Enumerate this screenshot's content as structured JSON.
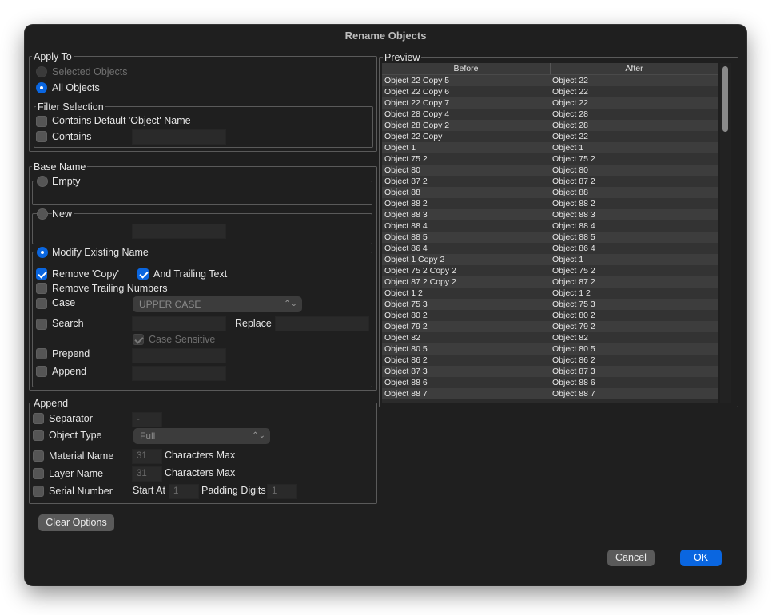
{
  "window": {
    "title": "Rename Objects"
  },
  "apply_to": {
    "legend": "Apply To",
    "selected_objects": "Selected Objects",
    "all_objects": "All Objects",
    "filter_legend": "Filter Selection",
    "contains_default": "Contains Default 'Object' Name",
    "contains": "Contains"
  },
  "base_name": {
    "legend": "Base Name",
    "empty": "Empty",
    "new": "New",
    "modify_existing": "Modify Existing Name",
    "remove_copy": "Remove 'Copy'",
    "and_trailing_text": "And Trailing Text",
    "remove_trailing_numbers": "Remove Trailing Numbers",
    "case": "Case",
    "case_value": "UPPER CASE",
    "search": "Search",
    "replace": "Replace",
    "case_sensitive": "Case Sensitive",
    "prepend": "Prepend",
    "append": "Append"
  },
  "append": {
    "legend": "Append",
    "separator": "Separator",
    "separator_value": "-",
    "object_type": "Object Type",
    "object_type_value": "Full",
    "material_name": "Material Name",
    "material_max": "31",
    "characters_max_1": "Characters Max",
    "layer_name": "Layer Name",
    "layer_max": "31",
    "characters_max_2": "Characters Max",
    "serial_number": "Serial Number",
    "start_at": "Start At",
    "start_at_value": "1",
    "padding_digits": "Padding Digits",
    "padding_value": "1"
  },
  "buttons": {
    "clear_options": "Clear Options",
    "cancel": "Cancel",
    "ok": "OK"
  },
  "preview": {
    "legend": "Preview",
    "col_before": "Before",
    "col_after": "After",
    "rows": [
      [
        "Object 22 Copy 5",
        "Object 22"
      ],
      [
        "Object 22 Copy 6",
        "Object 22"
      ],
      [
        "Object 22 Copy 7",
        "Object 22"
      ],
      [
        "Object 28 Copy 4",
        "Object 28"
      ],
      [
        "Object 28 Copy 2",
        "Object 28"
      ],
      [
        "Object 22 Copy",
        "Object 22"
      ],
      [
        "Object 1",
        "Object 1"
      ],
      [
        "Object 75 2",
        "Object 75 2"
      ],
      [
        "Object 80",
        "Object 80"
      ],
      [
        "Object 87 2",
        "Object 87 2"
      ],
      [
        "Object 88",
        "Object 88"
      ],
      [
        "Object 88 2",
        "Object 88 2"
      ],
      [
        "Object 88 3",
        "Object 88 3"
      ],
      [
        "Object 88 4",
        "Object 88 4"
      ],
      [
        "Object 88 5",
        "Object 88 5"
      ],
      [
        "Object 86 4",
        "Object 86 4"
      ],
      [
        "Object 1 Copy 2",
        "Object 1"
      ],
      [
        "Object 75 2 Copy 2",
        "Object 75 2"
      ],
      [
        "Object 87 2 Copy 2",
        "Object 87 2"
      ],
      [
        "Object 1 2",
        "Object 1 2"
      ],
      [
        "Object 75 3",
        "Object 75 3"
      ],
      [
        "Object 80 2",
        "Object 80 2"
      ],
      [
        "Object 79 2",
        "Object 79 2"
      ],
      [
        "Object 82",
        "Object 82"
      ],
      [
        "Object 80 5",
        "Object 80 5"
      ],
      [
        "Object 86 2",
        "Object 86 2"
      ],
      [
        "Object 87 3",
        "Object 87 3"
      ],
      [
        "Object 88 6",
        "Object 88 6"
      ],
      [
        "Object 88 7",
        "Object 88 7"
      ]
    ]
  }
}
